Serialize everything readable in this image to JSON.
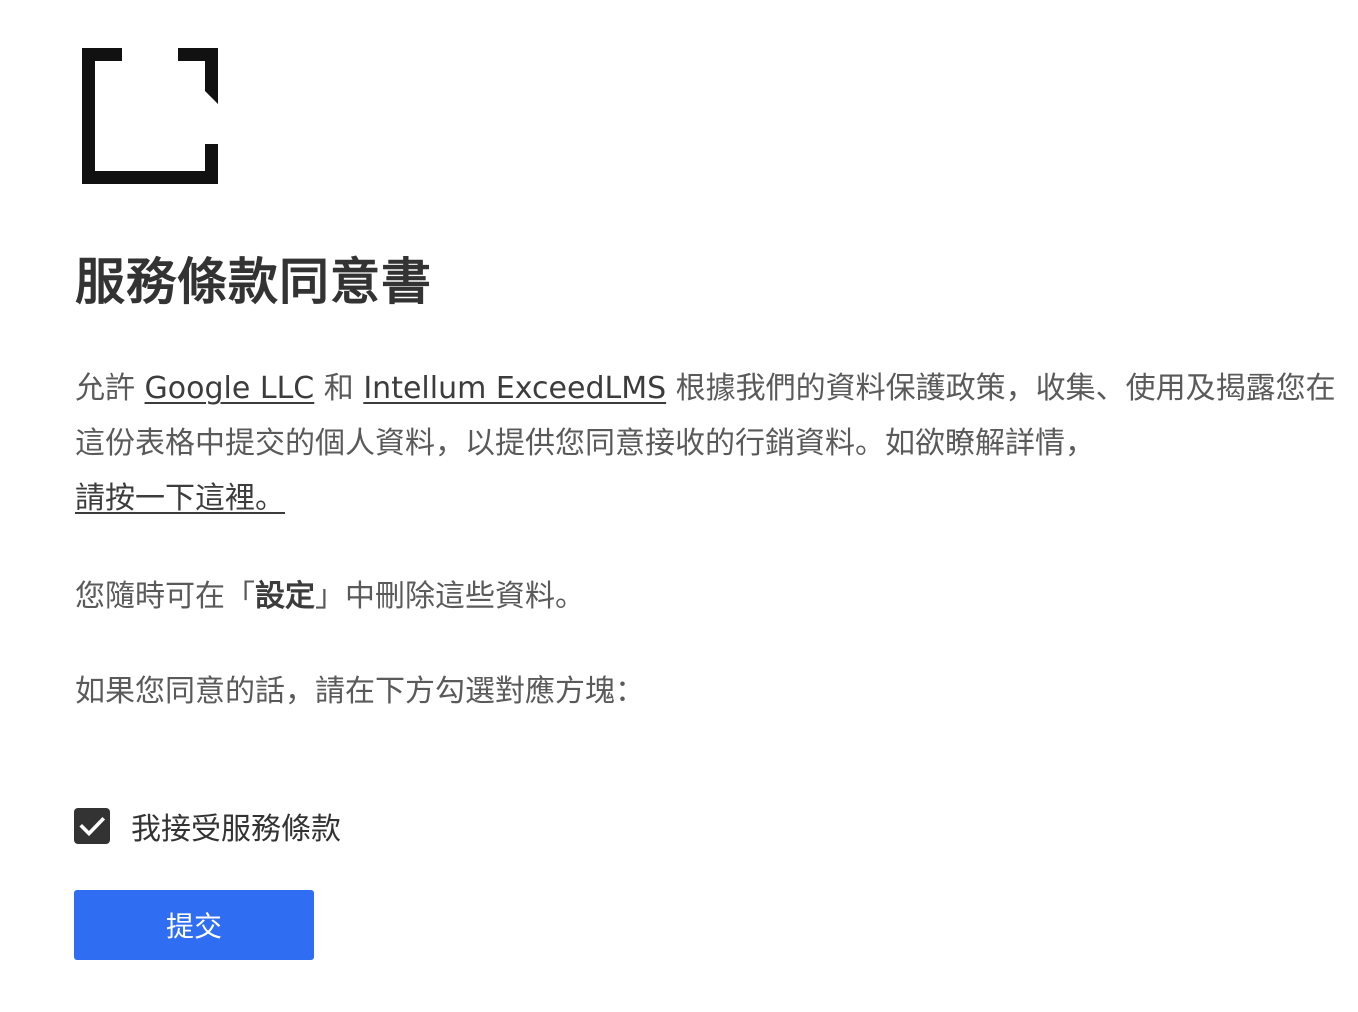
{
  "logo": {
    "icon": "bracket-frame-logo",
    "color": "#111111"
  },
  "title": "服務條款同意書",
  "intro": {
    "prefix": "允許 ",
    "company1": "Google LLC",
    "and": " 和 ",
    "company2": "Intellum ExceedLMS",
    "body": " 根據我們的資料保護政策，收集、使用及揭露您在這份表格中提交的個人資料，以提供您同意接收的行銷資料。如欲瞭解詳情，",
    "more_link": "請按一下這裡。"
  },
  "settings_note": {
    "prefix": "您隨時可在「",
    "settings_word": "設定",
    "suffix": "」中刪除這些資料。"
  },
  "instruction": "如果您同意的話，請在下方勾選對應方塊：",
  "consent": {
    "label": "我接受服務條款",
    "checked": true,
    "icon": "checkmark-icon"
  },
  "submit": {
    "label": "提交",
    "color": "#2f6ef2"
  }
}
